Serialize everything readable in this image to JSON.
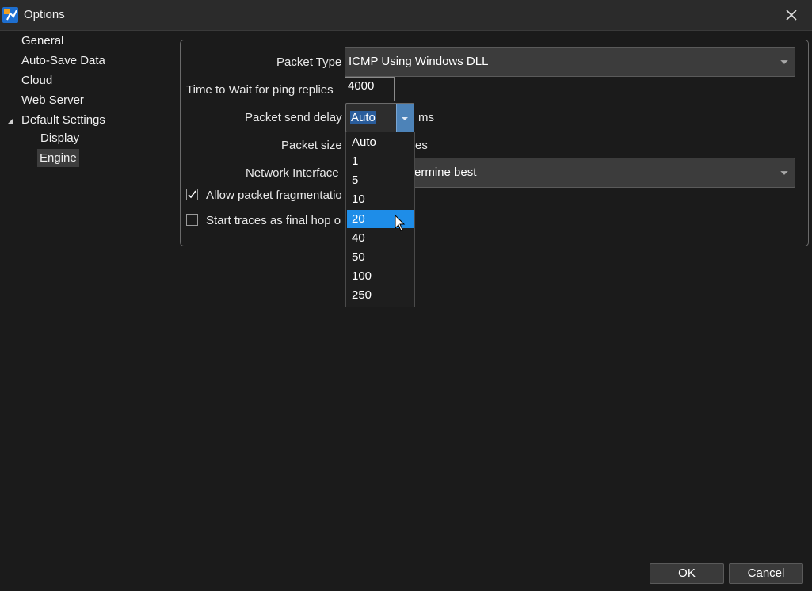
{
  "window": {
    "title": "Options"
  },
  "sidebar": {
    "items": [
      {
        "label": "General"
      },
      {
        "label": "Auto-Save Data"
      },
      {
        "label": "Cloud"
      },
      {
        "label": "Web Server"
      },
      {
        "label": "Default Settings",
        "expanded": true
      },
      {
        "label": "Display"
      },
      {
        "label": "Engine",
        "selected": true
      }
    ]
  },
  "form": {
    "packet_type_label": "Packet Type",
    "packet_type_value": "ICMP Using Windows DLL",
    "wait_label": "Time to Wait for ping replies",
    "wait_value": "4000",
    "send_delay_label": "Packet send delay",
    "send_delay_value": "Auto",
    "send_delay_unit": "ms",
    "packet_size_label": "Packet size",
    "packet_size_unit_partial": "es",
    "network_interface_label": "Network Interface",
    "network_interface_value_partial": "ermine best",
    "allow_frag_label": "Allow packet fragmentatio",
    "allow_frag_checked": true,
    "start_traces_label": "Start traces as final hop o",
    "start_traces_checked": false
  },
  "dropdown": {
    "options": [
      "Auto",
      "1",
      "5",
      "10",
      "20",
      "40",
      "50",
      "100",
      "250"
    ],
    "highlighted": "20"
  },
  "buttons": {
    "ok": "OK",
    "cancel": "Cancel"
  },
  "colors": {
    "accent": "#1e8de8",
    "background": "#1b1b1b",
    "titlebar": "#2b2b2b"
  }
}
